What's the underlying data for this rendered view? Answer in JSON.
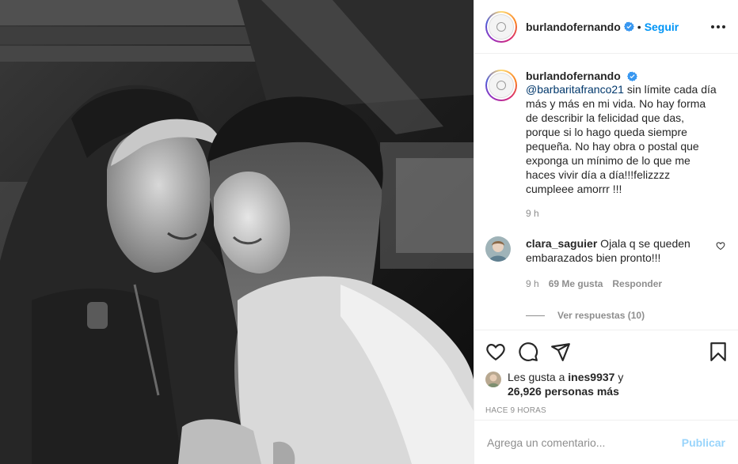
{
  "post": {
    "author": "burlandofernando",
    "follow_label": "Seguir",
    "dot": "•",
    "verified_icon": "verified-badge-icon",
    "more_icon": "more-options-icon"
  },
  "caption": {
    "user": "burlandofernando",
    "mention": "@barbaritafranco21",
    "text": " sin límite cada día más y más en mi vida. No hay forma de describir la felicidad que das, porque si lo hago queda siempre pequeña. No hay obra o postal que exponga un mínimo de lo que me haces vivir día a día!!!felizzzz cumpleee amorrr !!!",
    "time": "9 h"
  },
  "comments": [
    {
      "user": "clara_saguier",
      "text": " Ojala q se queden embarazados bien pronto!!!",
      "time": "9 h",
      "likes": "69 Me gusta",
      "reply_label": "Responder",
      "view_replies": "Ver respuestas (10)"
    }
  ],
  "actions": {
    "like_icon": "heart-icon",
    "comment_icon": "comment-icon",
    "share_icon": "send-icon",
    "save_icon": "bookmark-icon"
  },
  "likes": {
    "prefix": "Les gusta a ",
    "user": "ines9937",
    "middle": " y ",
    "count": "26,926 personas más"
  },
  "posted_ago": "HACE 9 HORAS",
  "add_comment": {
    "placeholder": "Agrega un comentario...",
    "publish_label": "Publicar"
  },
  "colors": {
    "link": "#0095f6",
    "mention": "#00376b",
    "text": "#262626",
    "muted": "#8e8e8e",
    "border": "#efefef"
  }
}
